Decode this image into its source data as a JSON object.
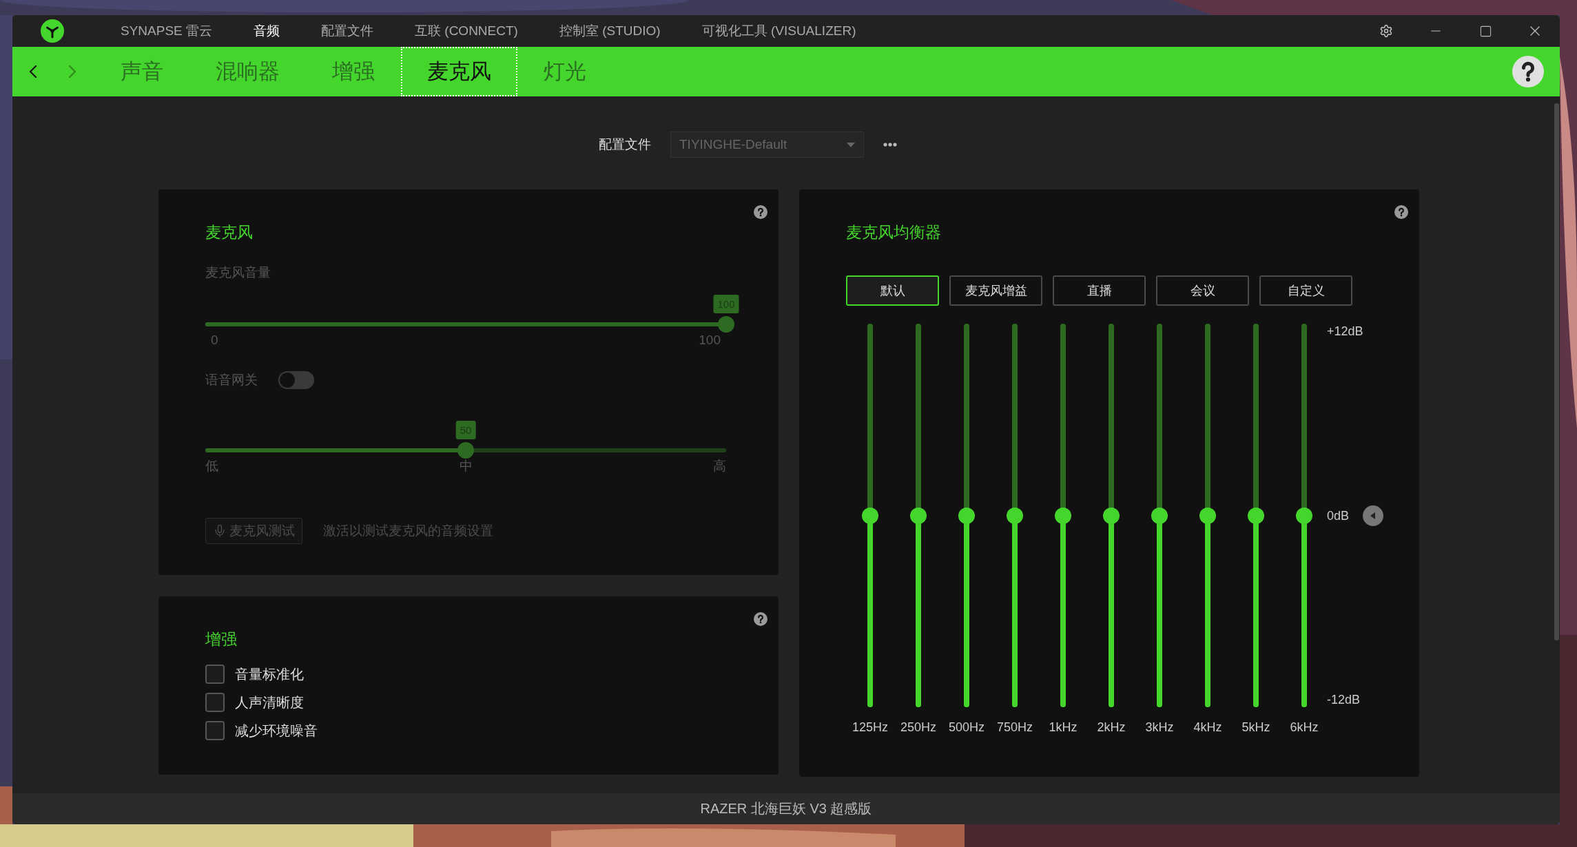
{
  "top_nav": [
    {
      "label": "SYNAPSE 雷云",
      "selected": false
    },
    {
      "label": "音频",
      "selected": true
    },
    {
      "label": "配置文件",
      "selected": false
    },
    {
      "label": "互联 (CONNECT)",
      "selected": false
    },
    {
      "label": "控制室 (STUDIO)",
      "selected": false
    },
    {
      "label": "可视化工具 (VISUALIZER)",
      "selected": false
    }
  ],
  "sub_tabs": [
    {
      "label": "声音",
      "selected": false
    },
    {
      "label": "混响器",
      "selected": false
    },
    {
      "label": "增强",
      "selected": false
    },
    {
      "label": "麦克风",
      "selected": true
    },
    {
      "label": "灯光",
      "selected": false
    }
  ],
  "profile": {
    "label": "配置文件",
    "value": "TIYINGHE-Default"
  },
  "microphone": {
    "title": "麦克风",
    "volume_label": "麦克风音量",
    "volume": {
      "reading": "100",
      "level": 1,
      "min_label": "0",
      "max_label": "100"
    },
    "voice_gate": {
      "label": "语音网关",
      "on": false
    },
    "sensitivity": {
      "reading": "50",
      "level": 0.5,
      "low_label": "低",
      "mid_label": "中",
      "high_label": "高"
    },
    "test_button": "麦克风测试",
    "test_hint": "激活以测试麦克风的音频设置"
  },
  "enhancement": {
    "title": "增强",
    "options": [
      {
        "label": "音量标准化",
        "checked": false
      },
      {
        "label": "人声清晰度",
        "checked": false
      },
      {
        "label": "减少环境噪音",
        "checked": false
      }
    ]
  },
  "equalizer": {
    "title": "麦克风均衡器",
    "presets": [
      {
        "label": "默认",
        "selected": true
      },
      {
        "label": "麦克风增益",
        "selected": false
      },
      {
        "label": "直播",
        "selected": false
      },
      {
        "label": "会议",
        "selected": false
      },
      {
        "label": "自定义",
        "selected": false
      }
    ],
    "scale": [
      "+12dB",
      "0dB",
      "-12dB"
    ],
    "bands": [
      {
        "label": "125Hz",
        "level": 0.5
      },
      {
        "label": "250Hz",
        "level": 0.5
      },
      {
        "label": "500Hz",
        "level": 0.5
      },
      {
        "label": "750Hz",
        "level": 0.5
      },
      {
        "label": "1kHz",
        "level": 0.5
      },
      {
        "label": "2kHz",
        "level": 0.5
      },
      {
        "label": "3kHz",
        "level": 0.5
      },
      {
        "label": "4kHz",
        "level": 0.5
      },
      {
        "label": "5kHz",
        "level": 0.5
      },
      {
        "label": "6kHz",
        "level": 0.5
      }
    ]
  },
  "status_bar": "RAZER 北海巨妖 V3 超感版"
}
